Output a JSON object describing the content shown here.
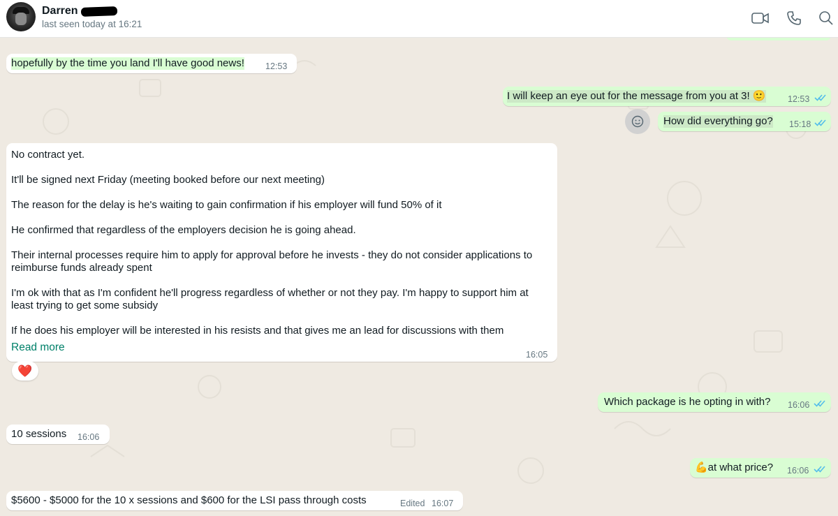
{
  "header": {
    "contact_name": "Darren",
    "last_seen": "last seen today at 16:21",
    "icons": [
      "video-call-icon",
      "voice-call-icon",
      "search-icon"
    ]
  },
  "messages": [
    {
      "direction": "in",
      "text": "hopefully by the time you land I'll have good news!",
      "time": "12:53"
    },
    {
      "direction": "out",
      "text": "I will keep an eye out for the message from you at 3! 🙂",
      "time": "12:53",
      "status": "read"
    },
    {
      "direction": "out",
      "text": "How did everything go?",
      "time": "15:18",
      "status": "read"
    },
    {
      "direction": "in",
      "time": "16:05",
      "read_more": "Read more",
      "reaction": "❤️",
      "paragraphs": [
        "No contract yet.",
        "It'll be signed next Friday (meeting booked before our next meeting)",
        "The reason for the delay is he's waiting to gain confirmation if his employer will fund 50% of it",
        "He confirmed that regardless of the employers decision he is going ahead.",
        "Their internal processes require him to apply for approval before he invests - they do not consider applications to reimburse funds already spent",
        "I'm ok with that as I'm confident he'll progress regardless of whether or not they pay. I'm happy to support him at least trying to get some subsidy",
        "If he does his employer will be interested in his resists and that gives me an lead for discussions with them"
      ]
    },
    {
      "direction": "out",
      "text": "Which package is he opting in with?",
      "time": "16:06",
      "status": "read"
    },
    {
      "direction": "in",
      "text": "10 sessions",
      "time": "16:06"
    },
    {
      "direction": "out",
      "text": "💪at what price?",
      "time": "16:06",
      "status": "read"
    },
    {
      "direction": "in",
      "text": "$5600 - $5000 for the 10 x sessions and $600 for the LSI pass through costs",
      "time": "16:07",
      "edited": "Edited"
    }
  ],
  "colors": {
    "background": "#efeae2",
    "incoming": "#ffffff",
    "outgoing": "#d9fdd3",
    "read_ticks": "#53bdeb",
    "read_more": "#008069"
  }
}
